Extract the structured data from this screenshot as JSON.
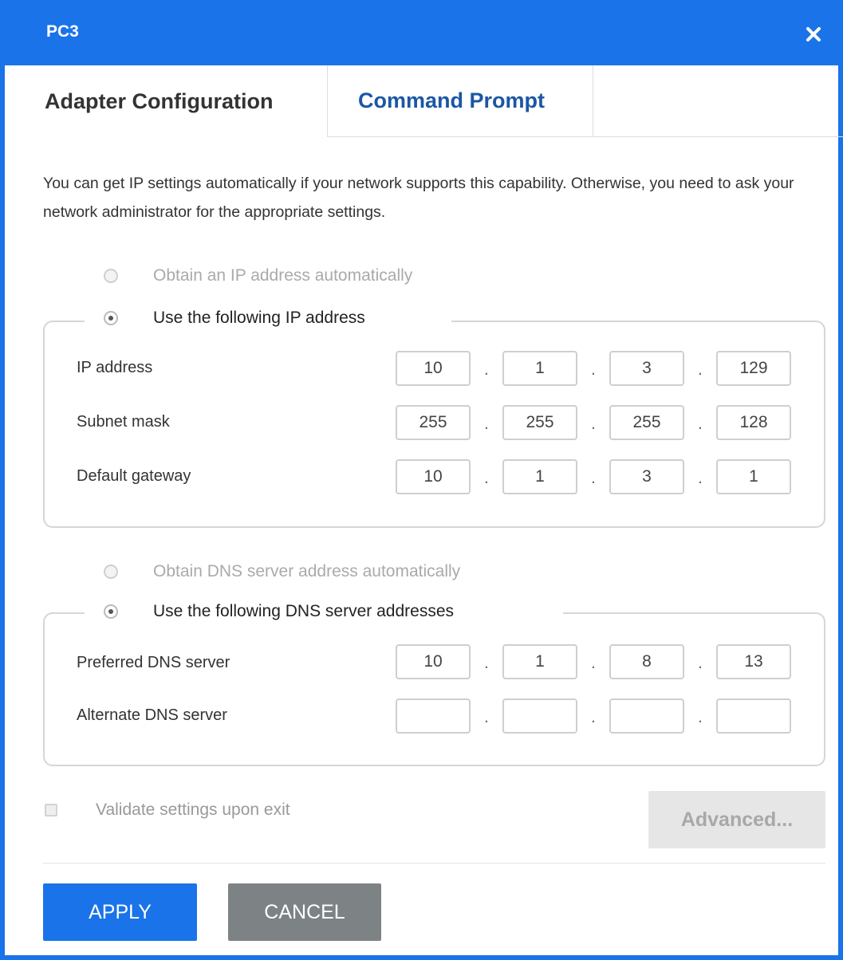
{
  "window": {
    "title": "PC3",
    "accent_color": "#1a73e8"
  },
  "tabs": [
    {
      "label": "Adapter Configuration",
      "active": true
    },
    {
      "label": "Command Prompt",
      "active": false
    }
  ],
  "description": "You can get IP settings automatically if your network supports this capability. Otherwise, you need to ask your network administrator for the appropriate settings.",
  "ip_section": {
    "auto_label": "Obtain an IP address automatically",
    "manual_label": "Use the following IP address",
    "selected": "manual",
    "fields": [
      {
        "label": "IP address",
        "octets": [
          "10",
          "1",
          "3",
          "129"
        ]
      },
      {
        "label": "Subnet mask",
        "octets": [
          "255",
          "255",
          "255",
          "128"
        ]
      },
      {
        "label": "Default gateway",
        "octets": [
          "10",
          "1",
          "3",
          "1"
        ]
      }
    ]
  },
  "dns_section": {
    "auto_label": "Obtain DNS server address automatically",
    "manual_label": "Use the following DNS server addresses",
    "selected": "manual",
    "fields": [
      {
        "label": "Preferred DNS server",
        "octets": [
          "10",
          "1",
          "8",
          "13"
        ]
      },
      {
        "label": "Alternate DNS server",
        "octets": [
          "",
          "",
          "",
          ""
        ]
      }
    ]
  },
  "validate": {
    "label": "Validate settings upon exit",
    "checked": false
  },
  "buttons": {
    "advanced": "Advanced...",
    "apply": "APPLY",
    "cancel": "CANCEL"
  },
  "separator_char": "."
}
